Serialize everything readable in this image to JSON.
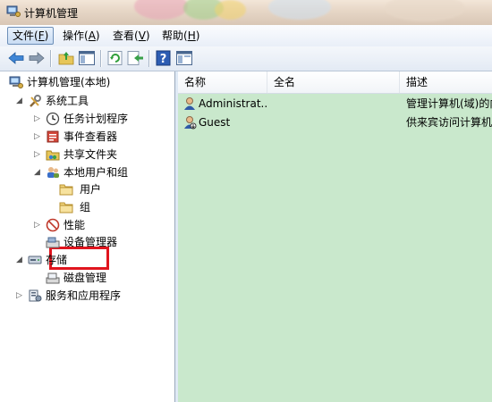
{
  "window": {
    "title": "计算机管理"
  },
  "menu": {
    "items": [
      {
        "label": "文件(",
        "key": "F",
        "end": ")"
      },
      {
        "label": "操作(",
        "key": "A",
        "end": ")"
      },
      {
        "label": "查看(",
        "key": "V",
        "end": ")"
      },
      {
        "label": "帮助(",
        "key": "H",
        "end": ")"
      }
    ]
  },
  "toolbar": {
    "icons": [
      "back-arrow-icon",
      "forward-arrow-icon",
      "up-folder-icon",
      "show-hide-tree-icon",
      "refresh-icon",
      "export-list-icon",
      "help-icon",
      "properties-icon"
    ]
  },
  "tree": {
    "root": "计算机管理(本地)",
    "system_tools": "系统工具",
    "task_scheduler": "任务计划程序",
    "event_viewer": "事件查看器",
    "shared_folders": "共享文件夹",
    "local_users_groups": "本地用户和组",
    "users": "用户",
    "groups": "组",
    "performance": "性能",
    "device_manager": "设备管理器",
    "storage": "存储",
    "disk_management": "磁盘管理",
    "services_apps": "服务和应用程序"
  },
  "list": {
    "columns": [
      "名称",
      "全名",
      "描述"
    ],
    "rows": [
      {
        "name": "Administrat...",
        "fullname": "",
        "description": "管理计算机(域)的内"
      },
      {
        "name": "Guest",
        "fullname": "",
        "description": "供来宾访问计算机"
      }
    ]
  },
  "colors": {
    "highlight_border": "#e0151e",
    "list_background": "#c9e8cc"
  }
}
